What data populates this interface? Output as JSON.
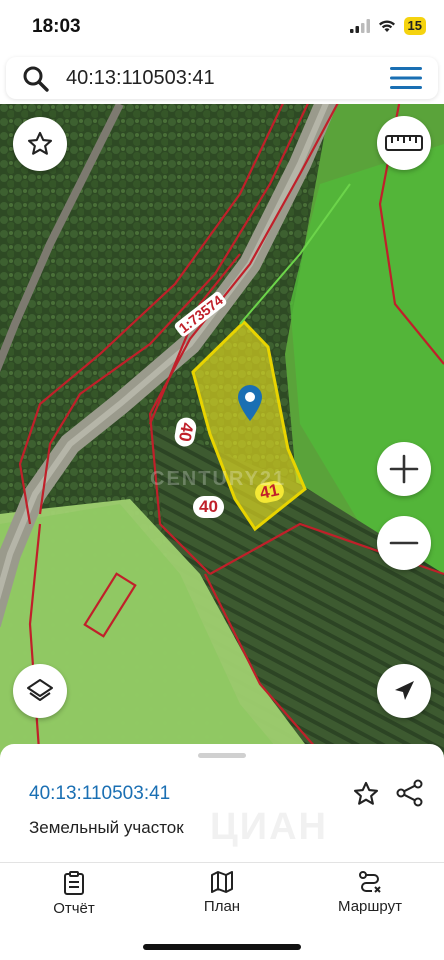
{
  "status": {
    "time": "18:03",
    "battery": "15"
  },
  "search": {
    "query": "40:13:110503:41"
  },
  "map": {
    "parcel_labels": [
      "40",
      "41",
      "40"
    ],
    "selected_parcel_label": "41",
    "road_label": "1:73574",
    "watermark": "CENTURY21",
    "selected_fill": "#f2e620",
    "boundary_color": "#c0202a"
  },
  "map_controls": [
    "star-icon",
    "ruler-icon",
    "zoom-in-icon",
    "zoom-out-icon",
    "layers-icon",
    "navigation-icon"
  ],
  "sheet": {
    "title": "40:13:110503:41",
    "subtitle": "Земельный участок",
    "watermark": "ЦИАН"
  },
  "tabs": [
    {
      "label": "Отчёт",
      "icon": "report-icon"
    },
    {
      "label": "План",
      "icon": "map-plan-icon"
    },
    {
      "label": "Маршрут",
      "icon": "route-icon"
    }
  ]
}
